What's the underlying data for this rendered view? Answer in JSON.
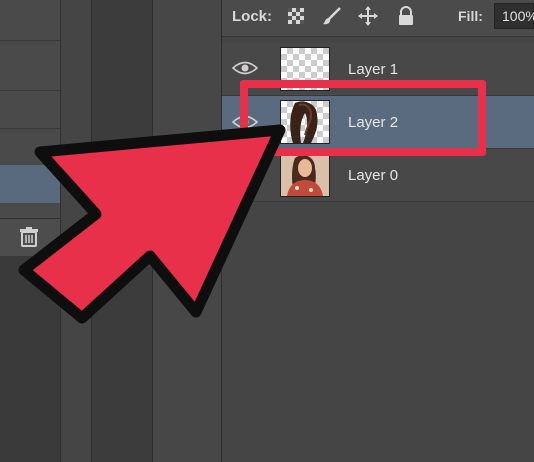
{
  "lock_bar": {
    "label": "Lock:",
    "icons": [
      "lock-transparent-icon",
      "lock-brush-icon",
      "lock-position-icon",
      "lock-all-icon"
    ],
    "fill_label": "Fill:",
    "fill_value": "100%"
  },
  "layers": [
    {
      "name": "Layer 1",
      "visible": true,
      "selected": false,
      "thumbnail": "transparent"
    },
    {
      "name": "Layer 2",
      "visible": true,
      "selected": true,
      "thumbnail": "hair-on-transparent"
    },
    {
      "name": "Layer 0",
      "visible": true,
      "selected": false,
      "thumbnail": "photo"
    }
  ],
  "left_panel": {
    "footer_icon": "trash-icon"
  },
  "annotation": {
    "highlight_color": "#e8304a",
    "arrow_color": "#e8304a",
    "target": "Layer 2"
  },
  "colors": {
    "selection": "#5a6b80",
    "panel": "#484848",
    "background": "#3b3b3b"
  }
}
